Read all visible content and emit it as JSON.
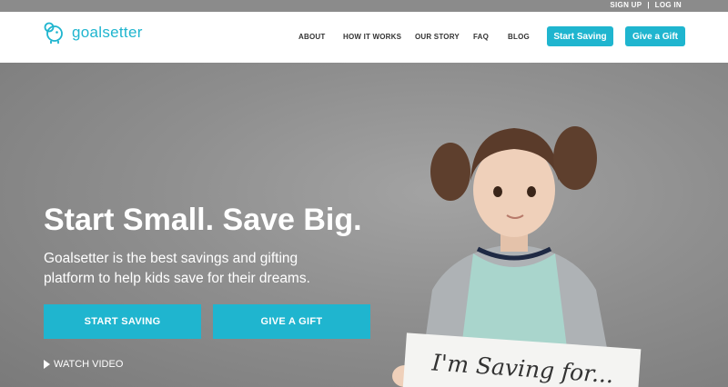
{
  "topbar": {
    "signup": "SIGN UP",
    "separator": "|",
    "login": "LOG IN"
  },
  "brand": {
    "name": "goalsetter",
    "accent": "#1fb5cf"
  },
  "nav": {
    "items": [
      "ABOUT",
      "HOW IT WORKS",
      "OUR STORY",
      "FAQ",
      "BLOG"
    ],
    "start_saving": "Start Saving",
    "give_gift": "Give a Gift"
  },
  "hero": {
    "headline": "Start Small. Save Big.",
    "subtext": "Goalsetter is the best savings and gifting platform to help kids save for their dreams.",
    "cta_primary": "START SAVING",
    "cta_secondary": "GIVE A GIFT",
    "watch_video": "WATCH VIDEO",
    "sign_text": "I'm Saving for..."
  }
}
